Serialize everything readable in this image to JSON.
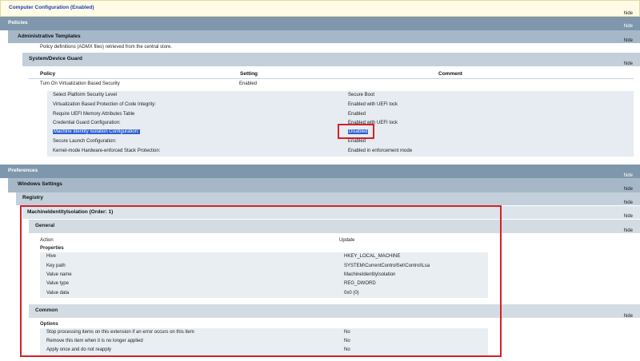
{
  "computer_config": {
    "title": "Computer Configuration (Enabled)",
    "hide": "hide"
  },
  "policies": {
    "title": "Policies",
    "hide": "hide",
    "admin_templates": {
      "title": "Administrative Templates",
      "hide": "hide",
      "note": "Policy definitions (ADMX files) retrieved from the central store.",
      "device_guard": {
        "title": "System/Device Guard",
        "hide": "hide",
        "headers": {
          "policy": "Policy",
          "setting": "Setting",
          "comment": "Comment"
        },
        "policy_link": "Turn On Virtualization Based Security",
        "policy_setting": "Enabled",
        "options": [
          {
            "label": "Select Platform Security Level",
            "value": "Secure Boot"
          },
          {
            "label": "Virtualization Based Protection of Code Integrity:",
            "value": "Enabled with UEFI lock"
          },
          {
            "label": "Require UEFI Memory Attributes Table",
            "value": "Enabled"
          },
          {
            "label": "Credential Guard Configuration:",
            "value": "Enabled with UEFI lock"
          },
          {
            "label": "Machine Identity Isolation Configuration:",
            "value": "Disabled"
          },
          {
            "label": "Secure Launch Configuration:",
            "value": "Enabled"
          },
          {
            "label": "Kernel-mode Hardware-enforced Stack Protection:",
            "value": "Enabled in enforcement mode"
          }
        ]
      }
    }
  },
  "preferences": {
    "title": "Preferences",
    "hide": "hide",
    "windows_settings": {
      "title": "Windows Settings",
      "hide": "hide",
      "registry": {
        "title": "Registry",
        "hide": "hide",
        "item": {
          "title": "MachineIdentityIsolation (Order: 1)",
          "hide": "hide",
          "general": {
            "title": "General",
            "hide": "hide",
            "action_label": "Action",
            "action_value": "Update",
            "properties_label": "Properties",
            "props": [
              {
                "label": "Hive",
                "value": "HKEY_LOCAL_MACHINE"
              },
              {
                "label": "Key path",
                "value": "SYSTEM\\CurrentControlSet\\Control\\Lsa"
              },
              {
                "label": "Value name",
                "value": "MachineIdentityIsolation"
              },
              {
                "label": "Value type",
                "value": "REG_DWORD"
              },
              {
                "label": "Value data",
                "value": "0x0 (0)"
              }
            ]
          },
          "common": {
            "title": "Common",
            "hide": "hide",
            "options_label": "Options",
            "options": [
              {
                "label": "Stop processing items on this extension if an error occurs on this item",
                "value": "No"
              },
              {
                "label": "Remove this item when it is no longer applied",
                "value": "No"
              },
              {
                "label": "Apply once and do not reapply",
                "value": "No"
              }
            ]
          }
        }
      }
    }
  },
  "colors": {
    "highlight_box": "#d42129",
    "link": "#2144c2",
    "selection": "#2f5fcf"
  }
}
